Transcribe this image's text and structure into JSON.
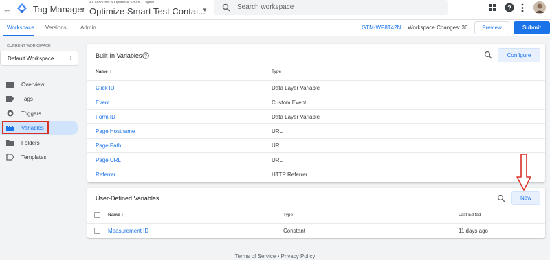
{
  "topbar": {
    "back_icon": "arrow-back-icon",
    "brand": "Tag Manager",
    "account_path": "All accounts > Optimize Smart - Digital...",
    "container_name": "Optimize Smart Test Contai...",
    "search_placeholder": "Search workspace",
    "icons": [
      "apps-grid-icon",
      "help-icon",
      "more-vert-icon",
      "avatar"
    ]
  },
  "tabs": {
    "items": [
      "Workspace",
      "Versions",
      "Admin"
    ],
    "active": "Workspace",
    "container_id": "GTM-WP8T42N",
    "workspace_changes": "Workspace Changes: 36",
    "preview_label": "Preview",
    "submit_label": "Submit"
  },
  "sidebar": {
    "current_workspace_label": "CURRENT WORKSPACE",
    "workspace_name": "Default Workspace",
    "items": [
      {
        "label": "Overview",
        "icon": "folder-icon"
      },
      {
        "label": "Tags",
        "icon": "tag-icon"
      },
      {
        "label": "Triggers",
        "icon": "trigger-icon"
      },
      {
        "label": "Variables",
        "icon": "variables-icon"
      },
      {
        "label": "Folders",
        "icon": "folder-icon"
      },
      {
        "label": "Templates",
        "icon": "template-icon"
      }
    ],
    "active": "Variables"
  },
  "builtin": {
    "title": "Built-In Variables",
    "configure_label": "Configure",
    "col_name": "Name",
    "col_type": "Type",
    "rows": [
      {
        "name": "Click ID",
        "type": "Data Layer Variable"
      },
      {
        "name": "Event",
        "type": "Custom Event"
      },
      {
        "name": "Form ID",
        "type": "Data Layer Variable"
      },
      {
        "name": "Page Hostname",
        "type": "URL"
      },
      {
        "name": "Page Path",
        "type": "URL"
      },
      {
        "name": "Page URL",
        "type": "URL"
      },
      {
        "name": "Referrer",
        "type": "HTTP Referrer"
      }
    ]
  },
  "userdefined": {
    "title": "User-Defined Variables",
    "new_label": "New",
    "col_name": "Name",
    "col_type": "Type",
    "col_last_edited": "Last Edited",
    "rows": [
      {
        "name": "Measurement ID",
        "type": "Constant",
        "last_edited": "11 days ago"
      }
    ]
  },
  "footer": {
    "terms": "Terms of Service",
    "separator": "•",
    "privacy": "Privacy Policy"
  },
  "colors": {
    "accent": "#1a73e8",
    "highlight_box": "#d93025",
    "active_nav_bg": "#d2e3fc"
  }
}
